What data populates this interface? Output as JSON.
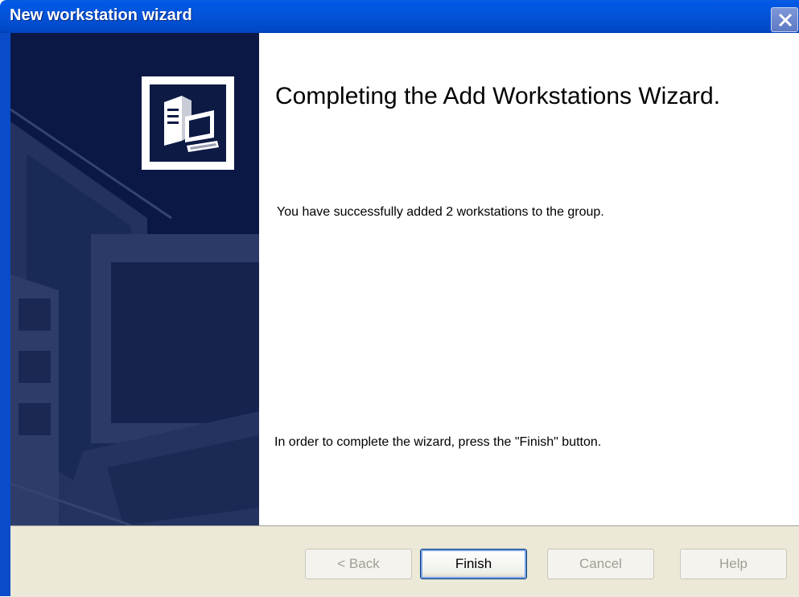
{
  "window": {
    "title": "New workstation wizard",
    "close_icon": "close-icon"
  },
  "banner": {
    "logo_icon": "workstation-computer-icon"
  },
  "content": {
    "heading": "Completing the Add Workstations Wizard.",
    "success_text": "You have successfully added 2 workstations to the group.",
    "instruction_text": "In order to complete the wizard, press the \"Finish\" button."
  },
  "buttons": {
    "back": {
      "label": "< Back",
      "enabled": false
    },
    "finish": {
      "label": "Finish",
      "enabled": true,
      "default": true
    },
    "cancel": {
      "label": "Cancel",
      "enabled": false
    },
    "help": {
      "label": "Help",
      "enabled": false
    }
  },
  "colors": {
    "titlebar": "#0058e6",
    "banner": "#0b1846",
    "button_bar": "#ece9d8",
    "focus_border": "#003c74"
  }
}
